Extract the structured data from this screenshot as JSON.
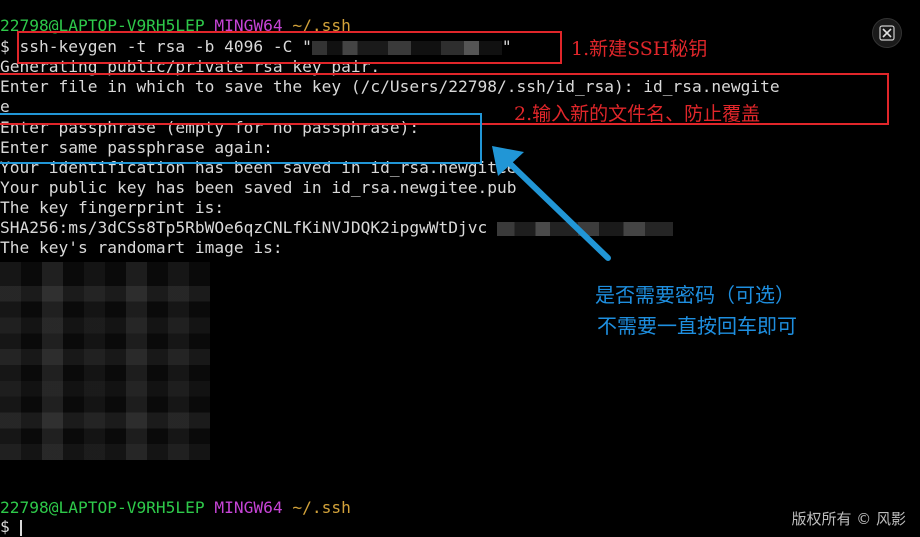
{
  "prompt_header": {
    "user_host": "22798@LAPTOP-V9RH5LEP",
    "shell": "MINGW64",
    "path": "~/.ssh"
  },
  "lines": {
    "cmd": "$ ssh-keygen -t rsa -b 4096 -C \"",
    "cmd_close": "\"",
    "gen": "Generating public/private rsa key pair.",
    "enter_file": "Enter file in which to save the key (/c/Users/22798/.ssh/id_rsa): id_rsa.newgite",
    "enter_file_wrap": "e",
    "passphrase": "Enter passphrase (empty for no passphrase):",
    "passphrase_again": "Enter same passphrase again:",
    "saved_id": "Your identification has been saved in id_rsa.newgitee",
    "saved_pub": "Your public key has been saved in id_rsa.newgitee.pub",
    "fingerprint_label": "The key fingerprint is:",
    "fingerprint": "SHA256:ms/3dCSs8Tp5RbWOe6qzCNLfKiNVJDQK2ipgwWtDjvc",
    "randomart": "The key's randomart image is:",
    "final_prompt": "$ "
  },
  "annotations": {
    "step1": "1.新建SSH秘钥",
    "step2": "2.输入新的文件名、防止覆盖",
    "note_line1": "是否需要密码（可选）",
    "note_line2": "不需要一直按回车即可"
  },
  "watermark": "版权所有 © 风影",
  "icons": {
    "close": "close-x-icon",
    "arrow": "arrow-up-left-icon"
  },
  "colors": {
    "prompt_user": "#2ec94a",
    "prompt_shell": "#c644d6",
    "prompt_path": "#d2a23a",
    "annotation_red": "#e0262a",
    "annotation_blue": "#2196d6"
  }
}
